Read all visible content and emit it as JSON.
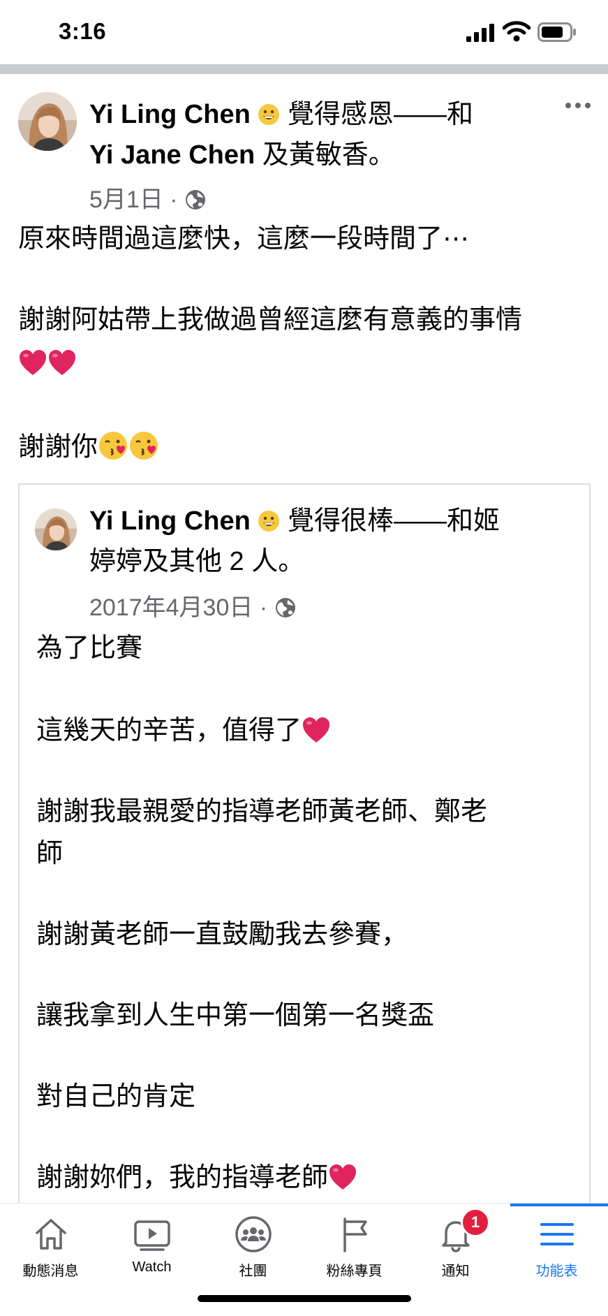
{
  "status_bar": {
    "time": "3:16"
  },
  "post": {
    "author": "Yi Ling Chen",
    "feeling_text": "覺得感恩——和",
    "tagged_name": "Yi Jane Chen",
    "tagged_suffix": "及黃敏香。",
    "date": "5月1日",
    "dot": "·",
    "body_line1": "原來時間過這麼快，這麼一段時間了⋯",
    "body_line2": "謝謝阿姑帶上我做過曾經這麼有意義的事情",
    "body_line4": "謝謝你"
  },
  "shared_post": {
    "author": "Yi Ling Chen",
    "feeling_text": "覺得很棒——和姬",
    "tag_line2": "婷婷及其他 2 人。",
    "date": "2017年4月30日",
    "dot": "·",
    "lines": [
      "為了比賽",
      "這幾天的辛苦，值得了",
      "謝謝我最親愛的指導老師黃老師、鄭老",
      "師",
      "謝謝黃老師一直鼓勵我去參賽，",
      "讓我拿到人生中第一個第一名獎盃",
      "對自己的肯定",
      "謝謝妳們，我的指導老師"
    ]
  },
  "bottom_nav": {
    "items": [
      {
        "label": "動態消息",
        "icon": "home-icon"
      },
      {
        "label": "Watch",
        "icon": "watch-icon"
      },
      {
        "label": "社團",
        "icon": "groups-icon"
      },
      {
        "label": "粉絲專頁",
        "icon": "flag-icon"
      },
      {
        "label": "通知",
        "icon": "bell-icon",
        "badge": "1"
      },
      {
        "label": "功能表",
        "icon": "menu-icon",
        "active": true
      }
    ]
  },
  "colors": {
    "accent": "#1877f2",
    "meta_gray": "#65676b",
    "badge_red": "#e41e3f",
    "heart_red": "#e0245e"
  }
}
